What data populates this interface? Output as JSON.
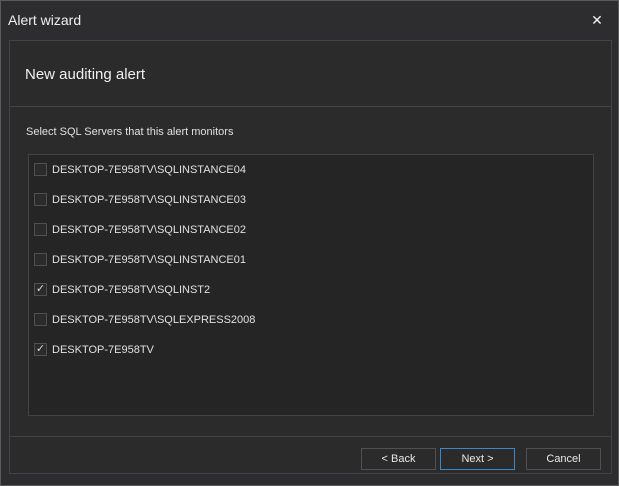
{
  "window": {
    "title": "Alert wizard",
    "close_glyph": "✕"
  },
  "header": {
    "title": "New auditing alert"
  },
  "instruction": "Select SQL Servers that this alert monitors",
  "servers": [
    {
      "label": "DESKTOP-7E958TV\\SQLINSTANCE04",
      "checked": false
    },
    {
      "label": "DESKTOP-7E958TV\\SQLINSTANCE03",
      "checked": false
    },
    {
      "label": "DESKTOP-7E958TV\\SQLINSTANCE02",
      "checked": false
    },
    {
      "label": "DESKTOP-7E958TV\\SQLINSTANCE01",
      "checked": false
    },
    {
      "label": "DESKTOP-7E958TV\\SQLINST2",
      "checked": true
    },
    {
      "label": "DESKTOP-7E958TV\\SQLEXPRESS2008",
      "checked": false
    },
    {
      "label": "DESKTOP-7E958TV",
      "checked": true
    }
  ],
  "checkmark_glyph": "✓",
  "buttons": {
    "back": "< Back",
    "next": "Next >",
    "cancel": "Cancel"
  },
  "colors": {
    "accent": "#3b87c9",
    "background": "#2d2d30"
  }
}
